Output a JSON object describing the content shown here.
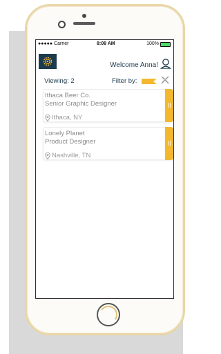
{
  "status_bar": {
    "carrier": "●●●●● Carrier",
    "time": "8:08 AM",
    "battery": "100%"
  },
  "header": {
    "welcome_text": "Welcome Anna!",
    "logo_icon": "gear-icon"
  },
  "filters": {
    "viewing": "Viewing: 2",
    "filter_label": "Filter by:",
    "filter_tag_color": "#f3b82e"
  },
  "jobs": [
    {
      "company": "Ithaca Beer Co.",
      "title": "Senior Graphic Designer",
      "location": "Ithaca, NY"
    },
    {
      "company": "Lonely Planet",
      "title": "Product Designer",
      "location": "Nashville, TN"
    }
  ],
  "colors": {
    "navy": "#1d3b4f",
    "accent": "#f3b82e",
    "phone_frame": "#e9d6a7"
  }
}
